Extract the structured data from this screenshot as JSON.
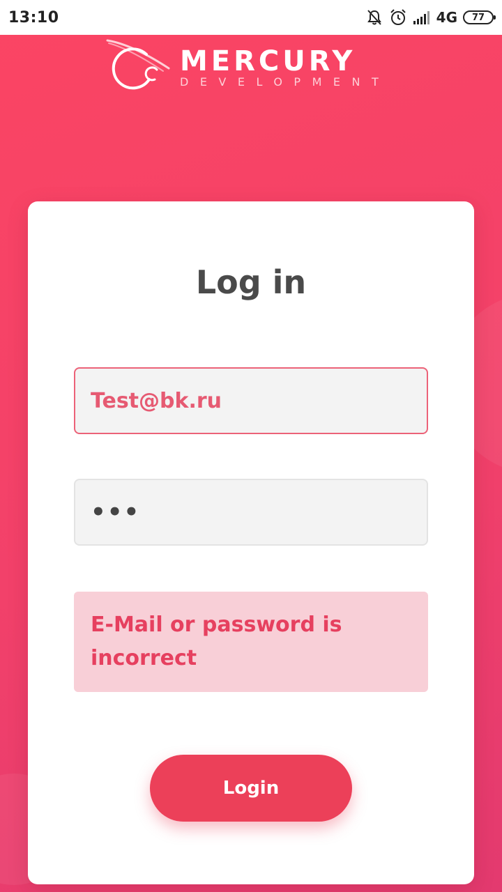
{
  "status_bar": {
    "time": "13:10",
    "network": "4G",
    "battery": "77",
    "icons": [
      "bell-off-icon",
      "alarm-icon",
      "signal-icon",
      "battery-icon"
    ]
  },
  "logo": {
    "wordmark": "MERCURY",
    "tagline": "DEVELOPMENT"
  },
  "login_form": {
    "title": "Log in",
    "email_value": "Test@bk.ru",
    "password_mask": "•••",
    "error_message": "E-Mail or password is incorrect",
    "submit_label": "Login"
  },
  "colors": {
    "background": "#f2416a",
    "accent": "#ec4059",
    "error_bg": "#f8cfd7",
    "error_text": "#e6405f",
    "title_text": "#4a4a4a"
  }
}
